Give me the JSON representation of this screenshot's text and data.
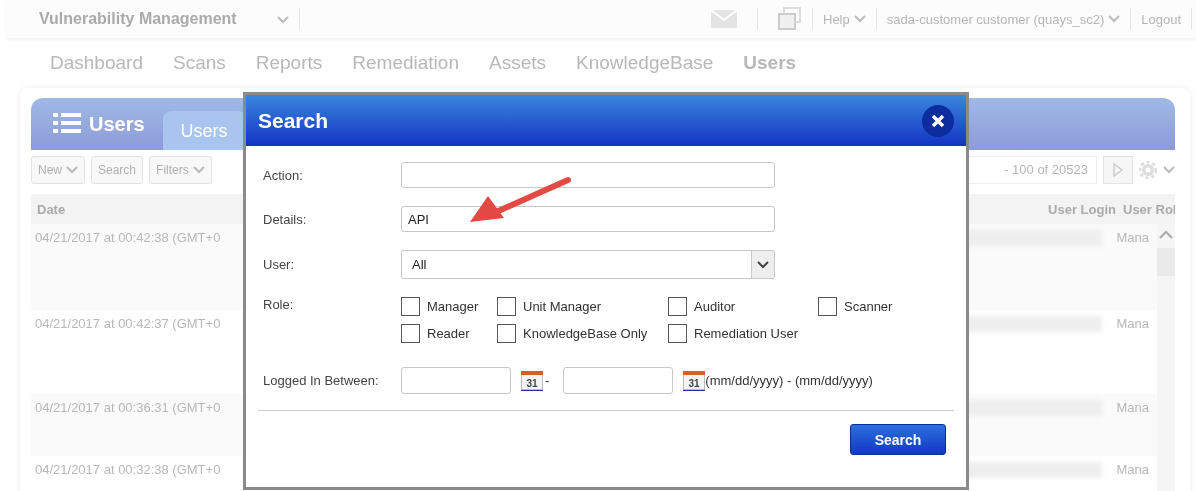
{
  "top_bar": {
    "app_title": "Vulnerability Management",
    "help": "Help",
    "user": "sada-customer customer (quays_sc2)",
    "logout": "Logout"
  },
  "nav": [
    {
      "label": "Dashboard",
      "selected": false
    },
    {
      "label": "Scans",
      "selected": false
    },
    {
      "label": "Reports",
      "selected": false
    },
    {
      "label": "Remediation",
      "selected": false
    },
    {
      "label": "Assets",
      "selected": false
    },
    {
      "label": "KnowledgeBase",
      "selected": false
    },
    {
      "label": "Users",
      "selected": true
    }
  ],
  "panel": {
    "title": "Users",
    "tabs": [
      {
        "label": "Users",
        "selected": true
      }
    ],
    "toolbar": {
      "buttons": [
        {
          "label": "New",
          "dropdown": true
        },
        {
          "label": "Search",
          "dropdown": false
        },
        {
          "label": "Filters",
          "dropdown": true
        }
      ],
      "pagination": "- 100 of 20523"
    },
    "table": {
      "columns": [
        "Date",
        "User Login",
        "User Rol"
      ],
      "rows": [
        {
          "date": "04/21/2017 at 00:42:38 (GMT+0",
          "role": "Mana"
        },
        {
          "date": "04/21/2017 at 00:42:37 (GMT+0",
          "role": "Mana"
        },
        {
          "date": "04/21/2017 at 00:36:31 (GMT+0",
          "role": "Mana"
        },
        {
          "date": "04/21/2017 at 00:32:38 (GMT+0",
          "role": "Mana"
        }
      ]
    }
  },
  "dialog": {
    "title": "Search",
    "fields": [
      {
        "kind": "text",
        "label": "Action:"
      },
      {
        "kind": "text",
        "label": "Details:",
        "value": "API"
      },
      {
        "kind": "select",
        "label": "User:",
        "value": "All"
      },
      {
        "kind": "checkboxes",
        "label": "Role:",
        "options": [
          {
            "label": "Manager",
            "checked": false
          },
          {
            "label": "Unit Manager",
            "checked": false
          },
          {
            "label": "Auditor",
            "checked": false
          },
          {
            "label": "Scanner",
            "checked": false
          },
          {
            "label": "Reader",
            "checked": false
          },
          {
            "label": "KnowledgeBase Only",
            "checked": false
          },
          {
            "label": "Remediation User",
            "checked": false
          }
        ]
      },
      {
        "kind": "date_range",
        "label": "Logged In Between:",
        "start_calendar_day": "31",
        "end_calendar_day": "31",
        "separator": "-",
        "hint": "(mm/dd/yyyy) - (mm/dd/yyyy)"
      }
    ],
    "button": "Search"
  }
}
